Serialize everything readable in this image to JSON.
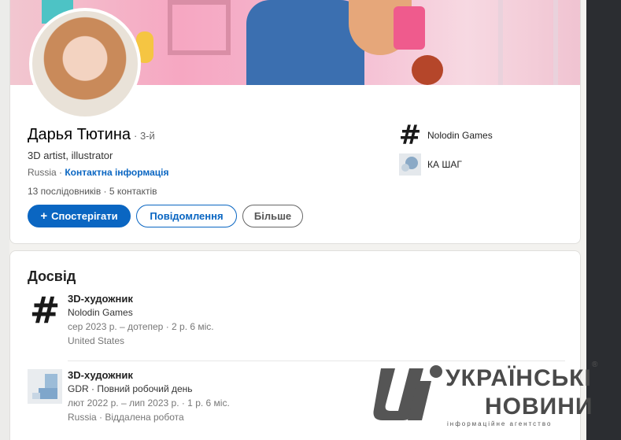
{
  "profile": {
    "name": "Дарья Тютина",
    "degree": "· 3-й",
    "headline": "3D artist, illustrator",
    "location": "Russia",
    "location_sep": " · ",
    "contact_link": "Контактна інформація",
    "followers": "13 послідовників",
    "stats_sep": " · ",
    "connections": "5 контактів",
    "buttons": {
      "follow": "Спостерігати",
      "follow_icon": "plus-icon",
      "message": "Повідомлення",
      "more": "Більше"
    },
    "orgs": [
      {
        "name": "Nolodin Games",
        "icon": "hash-logo-icon"
      },
      {
        "name": "КА ШАГ",
        "icon": "circles-logo-icon"
      }
    ]
  },
  "experience": {
    "title": "Досвід",
    "items": [
      {
        "role": "3D-художник",
        "company": "Nolodin Games",
        "dates": "сер 2023 р. – дотепер · 2 р. 6 міс.",
        "location": "United States",
        "icon": "hash-logo-icon"
      },
      {
        "role": "3D-художник",
        "company": "GDR · Повний робочий день",
        "dates": "лют 2022 р. – лип 2023 р. · 1 р. 6 міс.",
        "location": "Russia · Віддалена робота",
        "icon": "blocks-logo-icon"
      }
    ]
  },
  "watermark": {
    "line1": "УКРАЇНСЬКІ",
    "line2": "НОВИНИ",
    "tagline": "інформаційне агентство",
    "reg": "®"
  },
  "colors": {
    "accent": "#0a66c2",
    "background": "#f3f2ef"
  }
}
